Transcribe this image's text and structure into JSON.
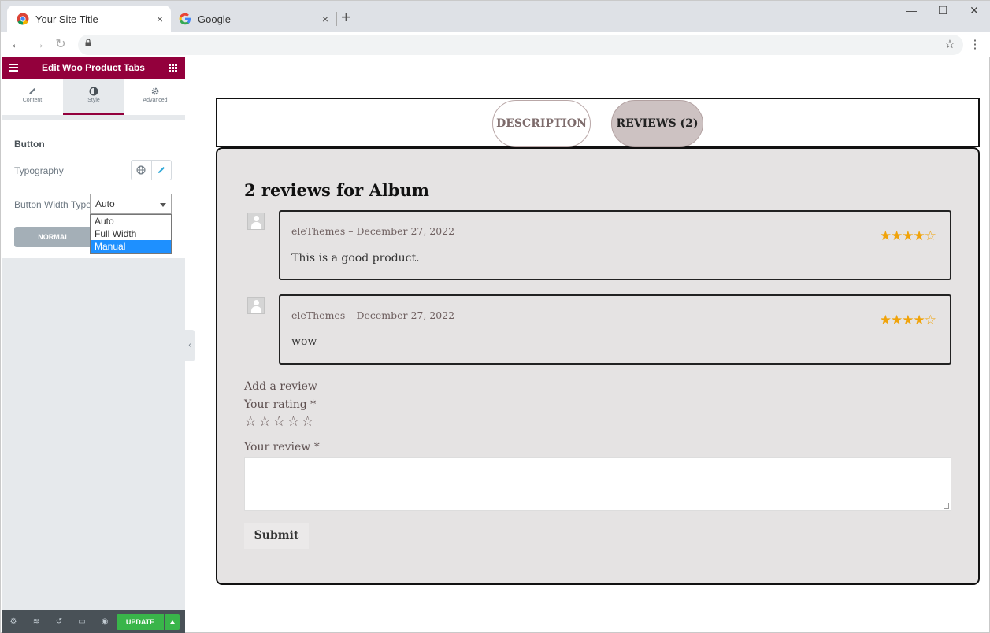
{
  "browser": {
    "tabs": [
      {
        "title": "Your Site Title",
        "close": "×"
      },
      {
        "title": "Google",
        "close": "×"
      }
    ],
    "new_tab": "+",
    "window_controls": [
      "—",
      "☐",
      "✕"
    ]
  },
  "editor": {
    "title": "Edit Woo Product Tabs",
    "tabs": [
      {
        "label": "Content",
        "icon": "pencil-icon"
      },
      {
        "label": "Style",
        "icon": "half-circle-icon"
      },
      {
        "label": "Advanced",
        "icon": "gear-icon"
      }
    ],
    "section_title": "Button",
    "typography_label": "Typography",
    "width_type_label": "Button Width Type",
    "width_type_value": "Auto",
    "width_type_options": [
      "Auto",
      "Full Width",
      "Manual"
    ],
    "width_type_highlighted": "Manual",
    "normal_label": "NORMAL",
    "update_label": "UPDATE",
    "accent_color": "#93003c"
  },
  "product_tabs": {
    "description_label": "DESCRIPTION",
    "reviews_label": "REVIEWS (2)"
  },
  "reviews": {
    "heading": "2 reviews for Album",
    "items": [
      {
        "meta": "eleThemes – December 27, 2022",
        "text": "This is a good product.",
        "rating": 4,
        "max": 5
      },
      {
        "meta": "eleThemes – December 27, 2022",
        "text": "wow",
        "rating": 4,
        "max": 5
      }
    ],
    "add_review": "Add a review",
    "your_rating": "Your rating *",
    "your_review": "Your review *",
    "submit_label": "Submit",
    "star_color": "#f0a30a"
  }
}
